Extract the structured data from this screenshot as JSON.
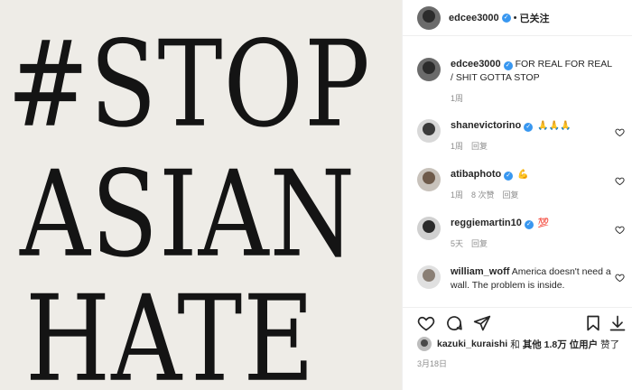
{
  "poster": {
    "line1": "#STOP",
    "line2": "ASIAN",
    "line3": "HATE"
  },
  "header": {
    "username": "edcee3000",
    "separator": "•",
    "follow_label": "已关注"
  },
  "caption": {
    "username": "edcee3000",
    "text": "FOR REAL FOR REAL / SHIT GOTTA STOP",
    "time": "1周"
  },
  "comments": [
    {
      "username": "shanevictorino",
      "text": "🙏🙏🙏",
      "time": "1周",
      "reply": "回复",
      "likes": ""
    },
    {
      "username": "atibaphoto",
      "text": "💪",
      "time": "1周",
      "likes": "8 次赞",
      "reply": "回复"
    },
    {
      "username": "reggiemartin10",
      "text": "💯",
      "time": "5天",
      "reply": "回复",
      "likes": ""
    },
    {
      "username": "william_woff",
      "text": "America doesn't need a wall. The problem is inside.",
      "time": "",
      "reply": "",
      "likes": ""
    }
  ],
  "likes_line": {
    "user": "kazuki_kuraishi",
    "and": "和",
    "others": "其他 1.8万 位用户",
    "suffix": "赞了"
  },
  "post_date": "3月18日",
  "colors": {
    "verified": "#3897f0",
    "muted": "#8e8e8e",
    "poster_bg": "#eeece7"
  }
}
